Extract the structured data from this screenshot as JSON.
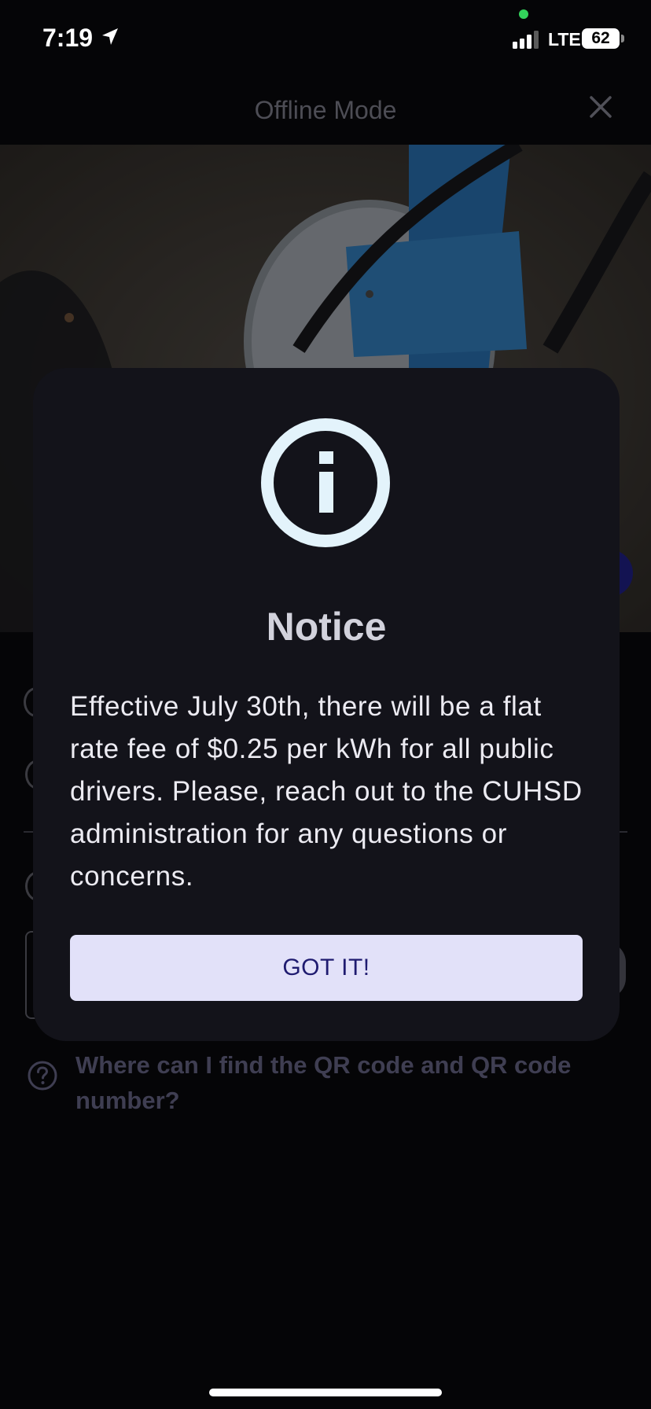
{
  "status_bar": {
    "time": "7:19",
    "network": "LTE",
    "battery": "62"
  },
  "header": {
    "title": "Offline Mode"
  },
  "help": {
    "link": "Where can I find the QR code and QR code number?"
  },
  "modal": {
    "title": "Notice",
    "message": "Effective July 30th, there will be a flat rate fee of $0.25 per kWh for all public drivers. Please, reach out to the CUHSD administration for any questions or concerns.",
    "button_label": "GOT IT!"
  },
  "colors": {
    "modal_background": "#13131a",
    "button_background": "#e2e1f9",
    "button_text": "#1f1b70",
    "info_icon": "#e3f3fb"
  }
}
